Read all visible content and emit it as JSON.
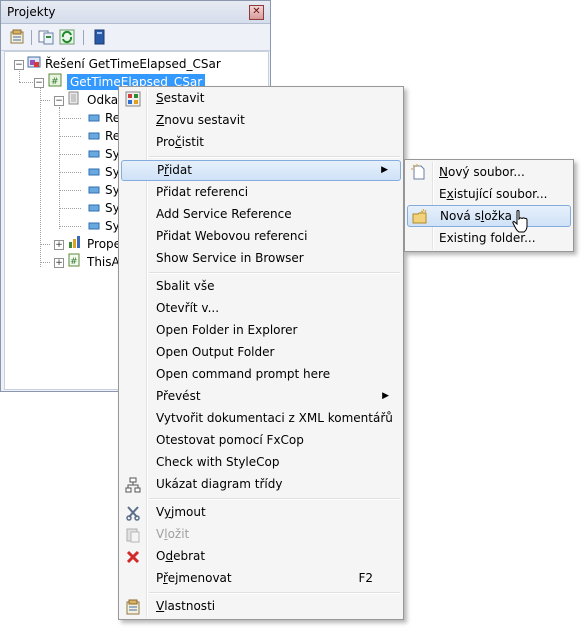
{
  "panel": {
    "title": "Projekty",
    "close_glyph": "✕",
    "toolbar": [
      "properties-icon",
      "show-all-files-icon",
      "refresh-icon",
      "class-view-icon"
    ]
  },
  "tree": {
    "solution": "Řešení GetTimeElapsed_CSar",
    "project": "GetTimeElapsed_CSar",
    "references_folder": "Odkaz",
    "refs": [
      "Re",
      "Re",
      "Sy",
      "Sy",
      "Sy",
      "Sy",
      "Sy",
      "Sy"
    ],
    "properties": "Prope",
    "this_addin": "ThisA"
  },
  "menu": {
    "items": [
      {
        "label": "Sestavit",
        "u": "S",
        "rest": "estavit"
      },
      {
        "label": "Znovu sestavit",
        "u": "Z",
        "rest": "novu sestavit"
      },
      {
        "pre": "Pro",
        "u": "č",
        "rest": "istit"
      },
      {
        "label": "Přidat",
        "pre": "P",
        "u": "ř",
        "rest": "idat"
      },
      {
        "label": "Přidat referenci"
      },
      {
        "label": "Add Service Reference"
      },
      {
        "label": "Přidat Webovou referenci"
      },
      {
        "label": "Show Service in Browser"
      },
      {
        "label": "Sbalit vše"
      },
      {
        "label": "Otevřít v..."
      },
      {
        "label": "Open Folder in Explorer"
      },
      {
        "label": "Open Output Folder"
      },
      {
        "label": "Open command prompt here"
      },
      {
        "label": "Převést"
      },
      {
        "label": "Vytvořit dokumentaci z XML komentářů"
      },
      {
        "label": "Otestovat pomocí FxCop"
      },
      {
        "label": "Check with StyleCop"
      },
      {
        "label": "Ukázat diagram třídy"
      },
      {
        "pre": "V",
        "u": "y",
        "rest": "jmout"
      },
      {
        "pre": "V",
        "u": "l",
        "rest": "ožit"
      },
      {
        "pre": "O",
        "u": "d",
        "rest": "ebrat"
      },
      {
        "pre": "P",
        "u": "ř",
        "rest": "ejmenovat",
        "shortcut": "F2"
      },
      {
        "pre": "",
        "u": "V",
        "rest": "lastnosti"
      }
    ]
  },
  "submenu": {
    "items": [
      {
        "pre": "",
        "u": "N",
        "rest": "ový soubor..."
      },
      {
        "pre": "E",
        "u": "x",
        "rest": "istující soubor..."
      },
      {
        "pre": "Nová s",
        "u": "l",
        "rest": "ožka"
      },
      {
        "label": "Existing folder..."
      }
    ]
  }
}
